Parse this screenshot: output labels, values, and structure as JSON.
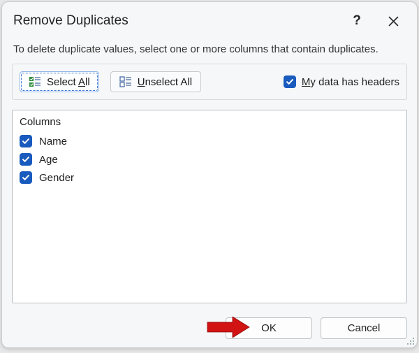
{
  "dialog": {
    "title": "Remove Duplicates",
    "help_symbol": "?",
    "instruction": "To delete duplicate values, select one or more columns that contain duplicates."
  },
  "toolbar": {
    "select_all": {
      "pre": "Select ",
      "accel": "A",
      "post": "ll"
    },
    "unselect_all": {
      "pre": "",
      "accel": "U",
      "post": "nselect All"
    },
    "headers": {
      "pre": "",
      "accel": "M",
      "post": "y data has headers",
      "checked": true
    }
  },
  "columns": {
    "header": "Columns",
    "items": [
      {
        "label": "Name",
        "checked": true
      },
      {
        "label": "Age",
        "checked": true
      },
      {
        "label": "Gender",
        "checked": true
      }
    ]
  },
  "buttons": {
    "ok": "OK",
    "cancel": "Cancel"
  }
}
